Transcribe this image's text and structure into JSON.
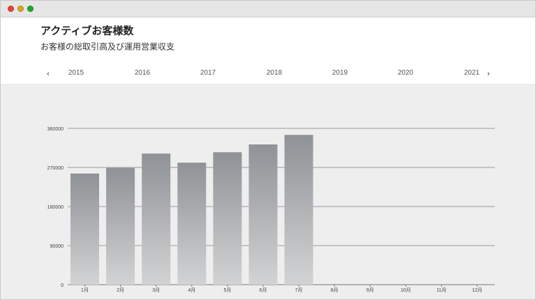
{
  "title": "アクティブお客様数",
  "subtitle": "お客様の総取引高及び運用営業収支",
  "year_nav": {
    "prev_icon": "chevron-left-icon",
    "next_icon": "chevron-right-icon",
    "prev_glyph": "‹",
    "next_glyph": "›",
    "years": [
      "2015",
      "2016",
      "2017",
      "2018",
      "2019",
      "2020",
      "2021"
    ]
  },
  "colors": {
    "bar_top": "#8f9296",
    "bar_bottom": "#d2d3d4",
    "chart_bg": "#eeeeee",
    "grid": "#9a9a9a"
  },
  "chart_data": {
    "type": "bar",
    "categories": [
      "1月",
      "2月",
      "3月",
      "4月",
      "5月",
      "6月",
      "7月",
      "8月",
      "9月",
      "10月",
      "11月",
      "12月"
    ],
    "values": [
      256000,
      269000,
      302000,
      281000,
      305000,
      323000,
      345000,
      null,
      null,
      null,
      null,
      null
    ],
    "ylim": [
      0,
      360000
    ],
    "yticks": [
      "0",
      "90000",
      "180000",
      "270000",
      "360000"
    ],
    "grid": true,
    "title": "",
    "xlabel": "",
    "ylabel": ""
  }
}
